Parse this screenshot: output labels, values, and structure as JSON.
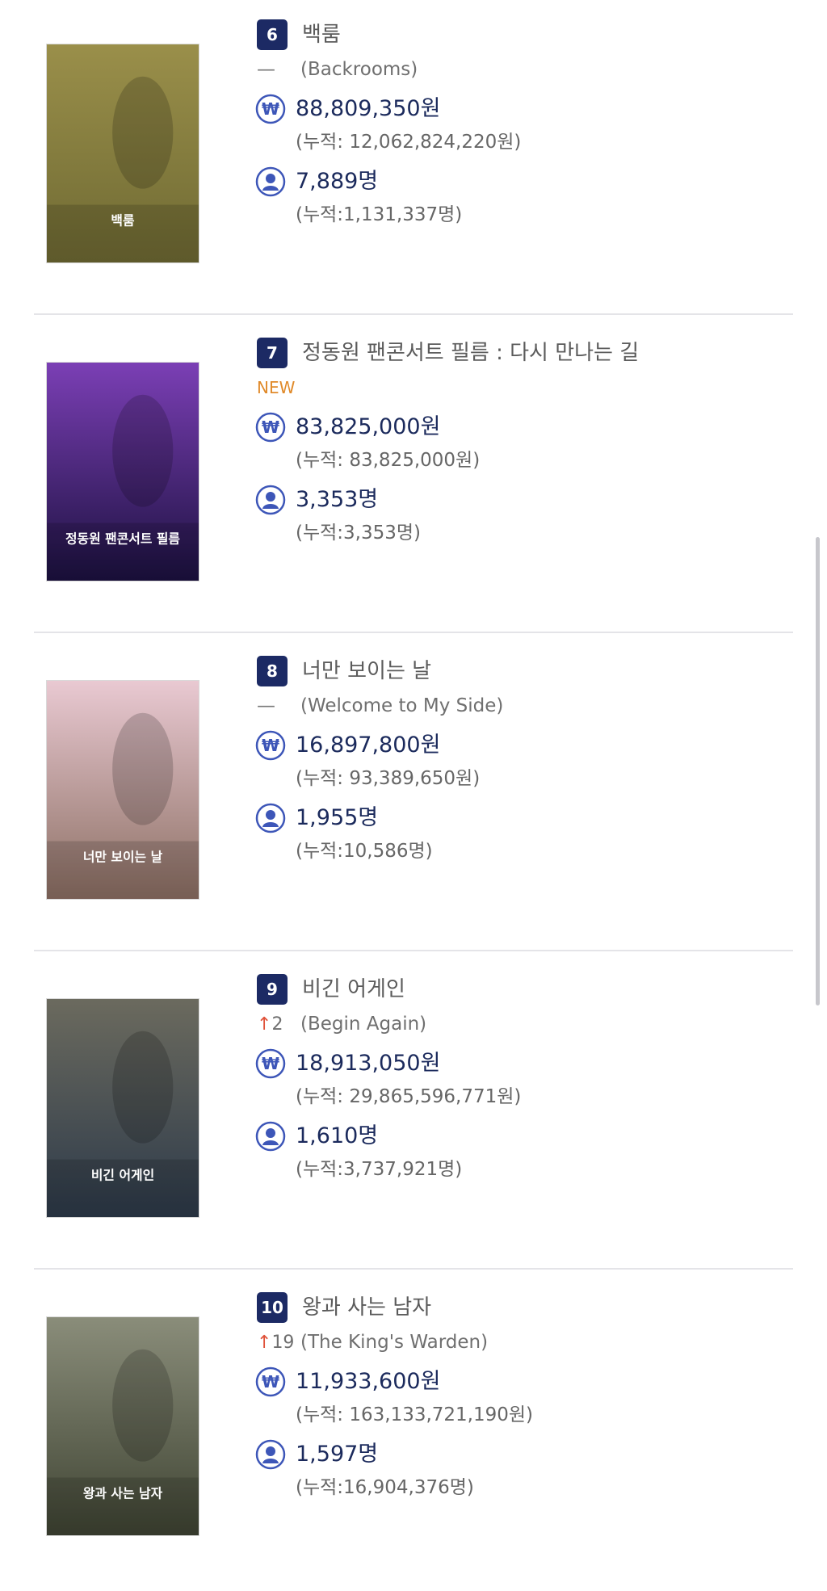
{
  "movies": [
    {
      "rank": "6",
      "title": "백룸",
      "change_mark": "—",
      "change_type": "same",
      "english_title": "(Backrooms)",
      "sales": "88,809,350원",
      "sales_cumulative": "(누적: 12,062,824,220원)",
      "audience": "7,889명",
      "audience_cumulative": "(누적:1,131,337명)",
      "poster_text": "백룸",
      "poster_colors": [
        "#9a8f4a",
        "#6f6a33"
      ]
    },
    {
      "rank": "7",
      "title": "정동원 팬콘서트 필름 : 다시 만나는 길",
      "change_mark": "NEW",
      "change_type": "new",
      "english_title": "",
      "sales": "83,825,000원",
      "sales_cumulative": "(누적: 83,825,000원)",
      "audience": "3,353명",
      "audience_cumulative": "(누적:3,353명)",
      "poster_text": "정동원 팬콘서트 필름",
      "poster_colors": [
        "#7b3fb5",
        "#1c1140"
      ]
    },
    {
      "rank": "8",
      "title": "너만 보이는 날",
      "change_mark": "—",
      "change_type": "same",
      "english_title": "(Welcome to My Side)",
      "sales": "16,897,800원",
      "sales_cumulative": "(누적: 93,389,650원)",
      "audience": "1,955명",
      "audience_cumulative": "(누적:10,586명)",
      "poster_text": "너만 보이는 날",
      "poster_colors": [
        "#e9c9d2",
        "#8c6f63"
      ]
    },
    {
      "rank": "9",
      "title": "비긴 어게인",
      "change_mark": "↑",
      "change_num": "2",
      "change_type": "up",
      "english_title": "(Begin Again)",
      "sales": "18,913,050원",
      "sales_cumulative": "(누적: 29,865,596,771원)",
      "audience": "1,610명",
      "audience_cumulative": "(누적:3,737,921명)",
      "poster_text": "비긴 어게인",
      "poster_colors": [
        "#6b6a5e",
        "#2d3a4a"
      ]
    },
    {
      "rank": "10",
      "title": "왕과 사는 남자",
      "change_mark": "↑",
      "change_num": "19",
      "change_type": "up",
      "english_title": "(The King's Warden)",
      "sales": "11,933,600원",
      "sales_cumulative": "(누적: 163,133,721,190원)",
      "audience": "1,597명",
      "audience_cumulative": "(누적:16,904,376명)",
      "poster_text": "왕과 사는 남자",
      "poster_colors": [
        "#8a8d7a",
        "#3f4433"
      ]
    }
  ],
  "icons": {
    "sales": "won-coin-icon",
    "audience": "person-icon"
  },
  "colors": {
    "rank_badge": "#1c2a64",
    "new_badge": "#e08a2a",
    "up_arrow": "#e0523a",
    "icon": "#3d56b8"
  }
}
